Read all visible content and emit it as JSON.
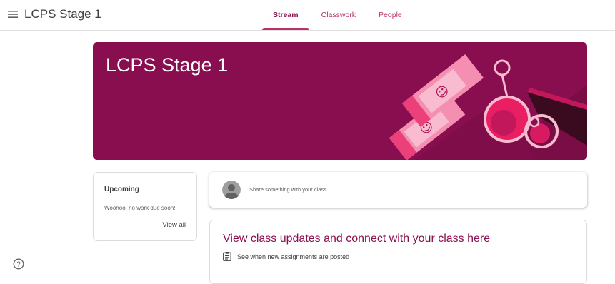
{
  "header": {
    "class_title": "LCPS Stage 1",
    "tabs": [
      {
        "label": "Stream",
        "active": true
      },
      {
        "label": "Classwork",
        "active": false
      },
      {
        "label": "People",
        "active": false
      }
    ]
  },
  "banner": {
    "title": "LCPS Stage 1",
    "background_color": "#880e4f"
  },
  "upcoming": {
    "title": "Upcoming",
    "empty_message": "Woohoo, no work due soon!",
    "view_all_label": "View all"
  },
  "share": {
    "placeholder": "Share something with your class..."
  },
  "updates": {
    "title": "View class updates and connect with your class here",
    "items": [
      {
        "icon": "assignment-icon",
        "text": "See when new assignments are posted"
      }
    ]
  },
  "colors": {
    "accent": "#8c1050",
    "tab_text": "#b8306c",
    "banner": "#880e4f"
  }
}
